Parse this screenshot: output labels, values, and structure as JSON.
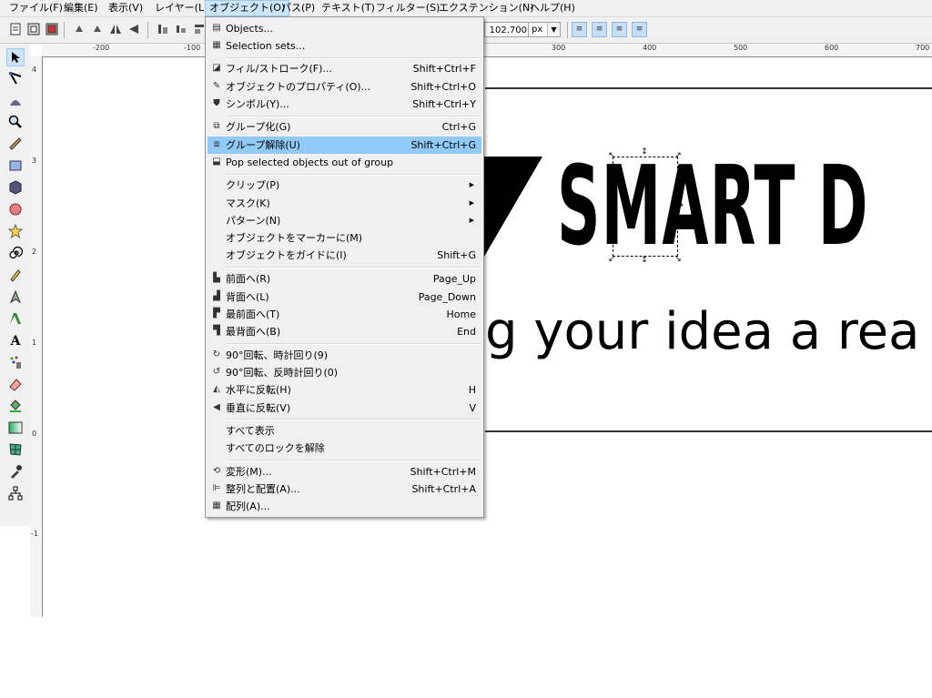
{
  "menubar": {
    "items": [
      {
        "label": "ファイル(F)"
      },
      {
        "label": "編集(E)"
      },
      {
        "label": "表示(V)"
      },
      {
        "label": "レイヤー(L)"
      },
      {
        "label": "オブジェクト(O)"
      },
      {
        "label": "パス(P)"
      },
      {
        "label": "テキスト(T)"
      },
      {
        "label": "フィルター(S)"
      },
      {
        "label": "エクステンション(N)"
      },
      {
        "label": "ヘルプ(H)"
      }
    ]
  },
  "toolbar": {
    "zoom_value": "102.700",
    "unit": "px"
  },
  "rulers": {
    "h_labels": [
      "-200",
      "-100",
      "300",
      "400",
      "500",
      "600",
      "700"
    ],
    "v_labels": [
      "4",
      "3",
      "2",
      "1",
      "0",
      "-1"
    ]
  },
  "canvas": {
    "logo_text": "SMART D",
    "tagline": "g your idea a rea"
  },
  "object_menu": {
    "items": [
      {
        "label": "Objects...",
        "shortcut": ""
      },
      {
        "label": "Selection sets...",
        "shortcut": ""
      },
      {
        "label": "フィル/ストローク(F)...",
        "shortcut": "Shift+Ctrl+F"
      },
      {
        "label": "オブジェクトのプロパティ(O)...",
        "shortcut": "Shift+Ctrl+O"
      },
      {
        "label": "シンボル(Y)...",
        "shortcut": "Shift+Ctrl+Y"
      },
      {
        "label": "グループ化(G)",
        "shortcut": "Ctrl+G"
      },
      {
        "label": "グループ解除(U)",
        "shortcut": "Shift+Ctrl+G"
      },
      {
        "label": "Pop selected objects out of group",
        "shortcut": ""
      },
      {
        "label": "クリップ(P)",
        "shortcut": ""
      },
      {
        "label": "マスク(K)",
        "shortcut": ""
      },
      {
        "label": "パターン(N)",
        "shortcut": ""
      },
      {
        "label": "オブジェクトをマーカーに(M)",
        "shortcut": ""
      },
      {
        "label": "オブジェクトをガイドに(I)",
        "shortcut": "Shift+G"
      },
      {
        "label": "前面へ(R)",
        "shortcut": "Page_Up"
      },
      {
        "label": "背面へ(L)",
        "shortcut": "Page_Down"
      },
      {
        "label": "最前面へ(T)",
        "shortcut": "Home"
      },
      {
        "label": "最背面へ(B)",
        "shortcut": "End"
      },
      {
        "label": "90°回転、時計回り(9)",
        "shortcut": ""
      },
      {
        "label": "90°回転、反時計回り(0)",
        "shortcut": ""
      },
      {
        "label": "水平に反転(H)",
        "shortcut": "H"
      },
      {
        "label": "垂直に反転(V)",
        "shortcut": "V"
      },
      {
        "label": "すべて表示",
        "shortcut": ""
      },
      {
        "label": "すべてのロックを解除",
        "shortcut": ""
      },
      {
        "label": "変形(M)...",
        "shortcut": "Shift+Ctrl+M"
      },
      {
        "label": "整列と配置(A)...",
        "shortcut": "Shift+Ctrl+A"
      },
      {
        "label": "配列(A)...",
        "shortcut": ""
      }
    ]
  }
}
